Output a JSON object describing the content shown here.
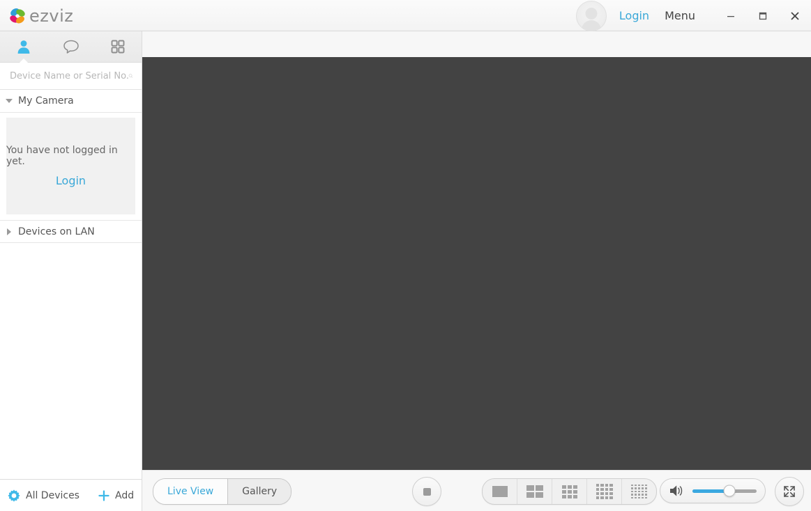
{
  "titlebar": {
    "brand_name": "ezviz",
    "login_label": "Login",
    "menu_label": "Menu",
    "minimize_label": "minimize-icon",
    "maximize_label": "maximize-icon",
    "close_label": "close-icon",
    "avatar_label": "avatar"
  },
  "sidebar": {
    "tabs": [
      {
        "name": "person-tab",
        "icon": "person-icon",
        "active": true
      },
      {
        "name": "message-tab",
        "icon": "speech-bubble-icon",
        "active": false
      },
      {
        "name": "apps-tab",
        "icon": "grid-apps-icon",
        "active": false
      }
    ],
    "search": {
      "placeholder": "Device Name or Serial No.",
      "value": "",
      "icon": "search-icon"
    },
    "my_camera": {
      "label": "My Camera",
      "expanded": true,
      "empty_text": "You have not logged in yet.",
      "login_label": "Login"
    },
    "devices_on_lan": {
      "label": "Devices on LAN",
      "expanded": false
    },
    "footer": {
      "all_devices_label": "All Devices",
      "all_devices_icon": "gear-icon",
      "add_label": "Add",
      "add_icon": "plus-icon"
    }
  },
  "main": {
    "video": {
      "background_color": "#434343",
      "content": ""
    },
    "bottombar": {
      "view_tabs": [
        {
          "label": "Live View",
          "active": true
        },
        {
          "label": "Gallery",
          "active": false
        }
      ],
      "stop_button": "stop-icon",
      "layouts": [
        {
          "name": "layout-1",
          "cols": 1,
          "rows": 1
        },
        {
          "name": "layout-4",
          "cols": 2,
          "rows": 2
        },
        {
          "name": "layout-9",
          "cols": 3,
          "rows": 3
        },
        {
          "name": "layout-16",
          "cols": 4,
          "rows": 4
        },
        {
          "name": "layout-25",
          "cols": 5,
          "rows": 5
        }
      ],
      "volume": {
        "icon": "speaker-icon",
        "level": 58
      },
      "fullscreen_icon": "fullscreen-icon"
    }
  },
  "colors": {
    "accent_blue": "#3aa8d8",
    "icon_blue": "#3fb9e8",
    "video_bg": "#434343",
    "text_gray": "#555555"
  }
}
